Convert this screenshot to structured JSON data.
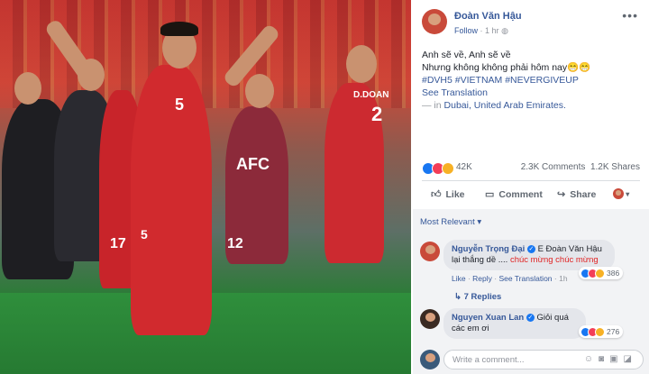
{
  "post": {
    "author": "Đoàn Văn Hậu",
    "follow": "Follow",
    "time": "1 hr",
    "caption_line1": "Anh sẽ về, Anh sẽ về",
    "caption_line2": "Nhưng không không phải hôm nay😁😁",
    "hashtags": "#DVH5 #VIETNAM #NEVERGIVEUP",
    "see_translation": "See Translation",
    "location_prefix": "— in",
    "location": "Dubai, United Arab Emirates."
  },
  "photo": {
    "numbers": [
      "5",
      "5",
      "17",
      "12",
      "D.DOAN",
      "2"
    ],
    "sponsor": "AFC"
  },
  "stats": {
    "reactions": "42K",
    "comments": "2.3K Comments",
    "shares": "1.2K Shares"
  },
  "actions": {
    "like": "Like",
    "comment": "Comment",
    "share": "Share"
  },
  "comments_section": {
    "sort": "Most Relevant ▾",
    "comments": [
      {
        "name": "Nguyễn Trọng Đại",
        "text": "E Đoàn Văn Hậu lại thắng dề ....",
        "highlight": "chúc mừng chúc mừng",
        "reactions": "386",
        "like": "Like",
        "reply": "Reply",
        "see_translation": "See Translation",
        "time": "1h",
        "replies": "7 Replies"
      },
      {
        "name": "Nguyen Xuan Lan",
        "text": "Giỏi quá",
        "text2": "các em ơi",
        "reactions": "276"
      }
    ],
    "write_placeholder": "Write a comment..."
  },
  "colors": {
    "link": "#365899",
    "like": "#1877f2",
    "love": "#f33e58",
    "haha": "#f7b125"
  }
}
